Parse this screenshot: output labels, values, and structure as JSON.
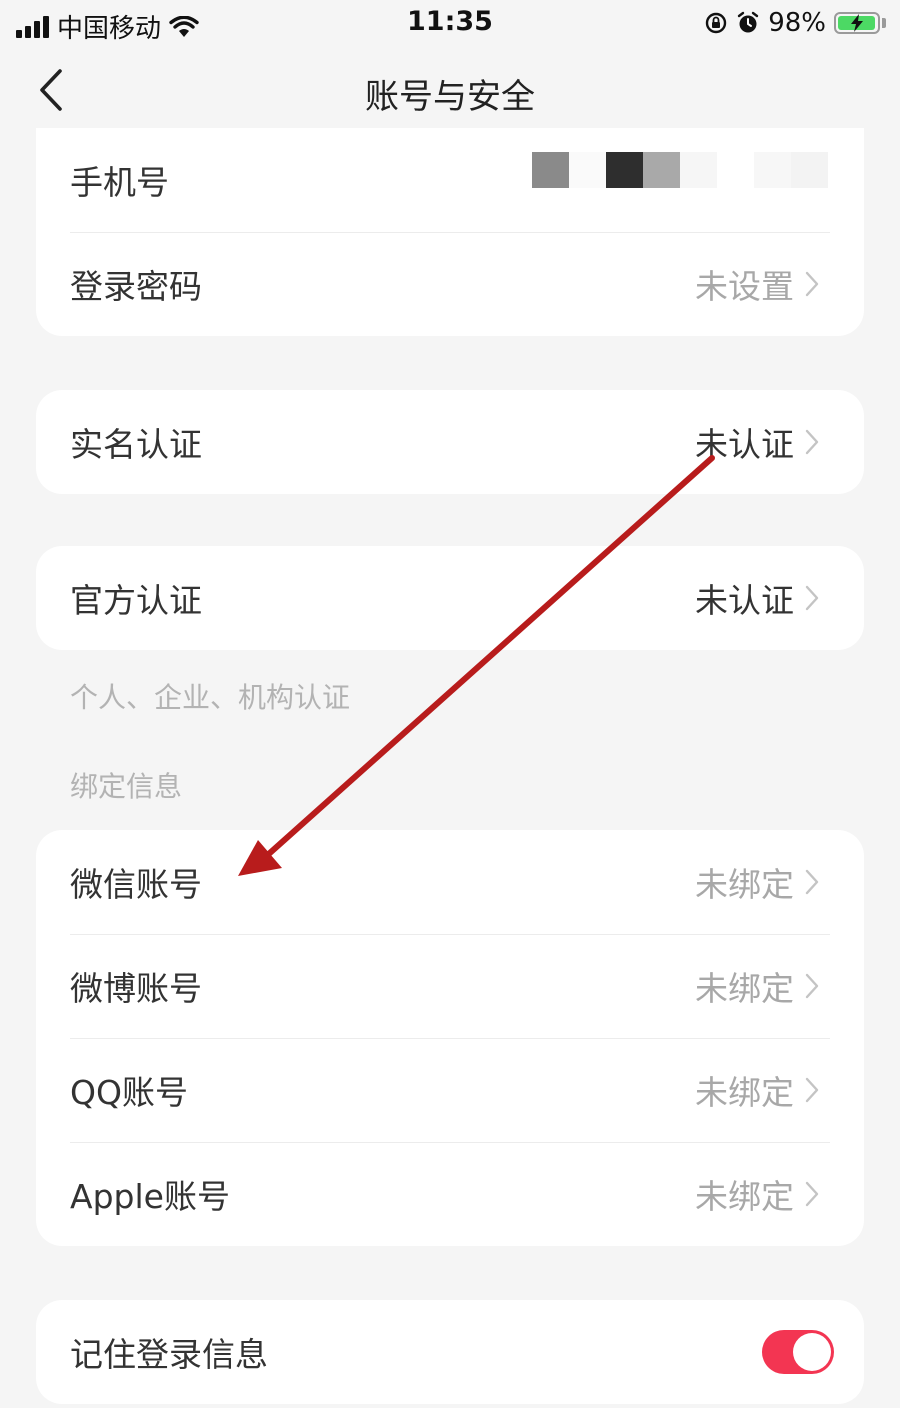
{
  "status": {
    "carrier": "中国移动",
    "time": "11:35",
    "battery": "98%",
    "icons": [
      "signal-icon",
      "wifi-icon",
      "orientation-lock-icon",
      "alarm-icon",
      "battery-icon"
    ]
  },
  "nav": {
    "title": "账号与安全",
    "back_icon": "chevron-left-icon"
  },
  "account": {
    "phone_label": "手机号",
    "password_label": "登录密码",
    "password_value": "未设置"
  },
  "identity": {
    "label": "实名认证",
    "value": "未认证"
  },
  "official": {
    "label": "官方认证",
    "value": "未认证",
    "hint": "个人、企业、机构认证"
  },
  "binding": {
    "section_title": "绑定信息",
    "items": [
      {
        "label": "微信账号",
        "value": "未绑定"
      },
      {
        "label": "微博账号",
        "value": "未绑定"
      },
      {
        "label": "QQ账号",
        "value": "未绑定"
      },
      {
        "label": "Apple账号",
        "value": "未绑定"
      }
    ]
  },
  "remember": {
    "label": "记住登录信息",
    "enabled": true
  },
  "colors": {
    "accent": "#f33552",
    "annotation_arrow": "#b81c1c",
    "background": "#f5f5f5"
  }
}
